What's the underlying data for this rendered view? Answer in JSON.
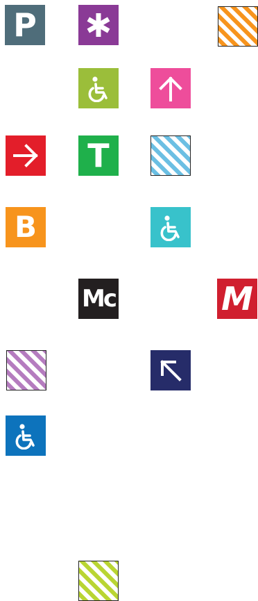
{
  "icons": {
    "parking": {
      "icon": "parking-letter-icon",
      "text": "P",
      "bg": "#4f6d7a"
    },
    "star": {
      "icon": "asterisk-icon",
      "bg": "#8a3a96"
    },
    "hatch_orange": {
      "icon": "hatched-orange-icon",
      "stripe": "#f7941d"
    },
    "wheel_lime": {
      "icon": "wheelchair-icon",
      "bg": "#9bbe3a"
    },
    "arrow_up": {
      "icon": "arrow-up-icon",
      "bg": "#ee4d9b"
    },
    "arrow_right": {
      "icon": "arrow-right-icon",
      "bg": "#e31e2a"
    },
    "tram": {
      "icon": "tram-letter-icon",
      "text": "T",
      "bg": "#1fb04b"
    },
    "hatch_blue": {
      "icon": "hatched-blue-icon",
      "stripe": "#6bbfe3"
    },
    "bus": {
      "icon": "bus-letter-icon",
      "text": "B",
      "bg": "#f7941d"
    },
    "wheel_teal": {
      "icon": "wheelchair-icon",
      "bg": "#38c2cb"
    },
    "mcdonalds": {
      "icon": "mc-letters-icon",
      "text": "Mc",
      "bg": "#231f20"
    },
    "metro": {
      "icon": "metro-letter-icon",
      "text": "M",
      "bg": "#d01f2f"
    },
    "hatch_purple": {
      "icon": "hatched-purple-icon",
      "stripe": "#b57cbf"
    },
    "arrow_diag": {
      "icon": "arrow-up-left-icon",
      "bg": "#262c69"
    },
    "wheel_blue": {
      "icon": "wheelchair-icon",
      "bg": "#0d73bc"
    },
    "hatch_lime": {
      "icon": "hatched-lime-icon",
      "stripe": "#b9d532"
    }
  }
}
